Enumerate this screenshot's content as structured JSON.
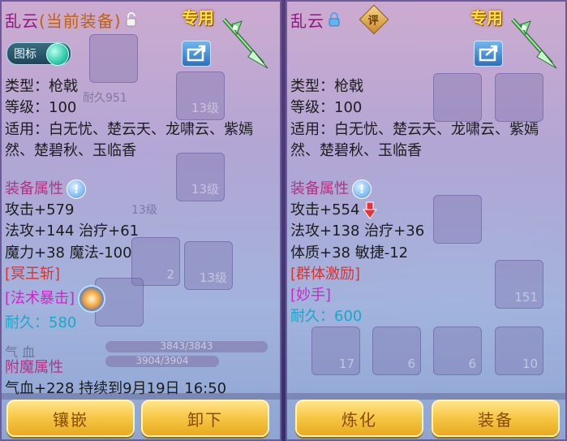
{
  "left_panel": {
    "name": "乱云",
    "current_tag": "(当前装备)",
    "exclusive_label": "专用",
    "icon_toggle_label": "图标",
    "type_line": "类型：枪戟",
    "level_line": "等级：100",
    "applies_line": "适用：白无忧、楚云天、龙啸云、紫嫣然、楚碧秋、玉临香",
    "attr_header": "装备属性",
    "attack": "攻击+579",
    "line2": "法攻+144 治疗+61",
    "line3": "魔力+38 魔法-100",
    "skill1": "[冥王斩]",
    "skill2": "[法术暴击]",
    "durability": "耐久：580",
    "bg_label": "气 血",
    "bg_bar_a": "3843/3843",
    "bg_bar_b": "3904/3904",
    "enchant_header": "附魔属性",
    "enchant_line": "气血+228 持续到9月19日 16:50",
    "bg_slot_a": "耐久951",
    "bg_slot_b": "13级",
    "bg_slot_c": "13级",
    "bg_slot_d": "2",
    "bg_slot_e": "13级",
    "bg_slot_f": "13级",
    "btn_inlay": "镶嵌",
    "btn_unequip": "卸下"
  },
  "right_panel": {
    "name": "乱云",
    "eval_badge": "评",
    "exclusive_label": "专用",
    "type_line": "类型：枪戟",
    "level_line": "等级：100",
    "applies_line": "适用：白无忧、楚云天、龙啸云、紫嫣然、楚碧秋、玉临香",
    "attr_header": "装备属性",
    "attack": "攻击+554",
    "line2": "法攻+138 治疗+36",
    "line3": "体质+38 敏捷-12",
    "skill1": "[群体激励]",
    "skill2": "[妙手]",
    "durability": "耐久：600",
    "bg_counts": [
      "151",
      "17",
      "6",
      "6",
      "10"
    ],
    "btn_refine": "炼化",
    "btn_equip": "装备"
  },
  "colors": {
    "title": "#8b1a7a",
    "attr_header": "#b23385",
    "red_skill": "#e0302e",
    "magenta_skill": "#d323c8",
    "durability": "#16a8c8",
    "button_gold": "#f7c94a"
  }
}
